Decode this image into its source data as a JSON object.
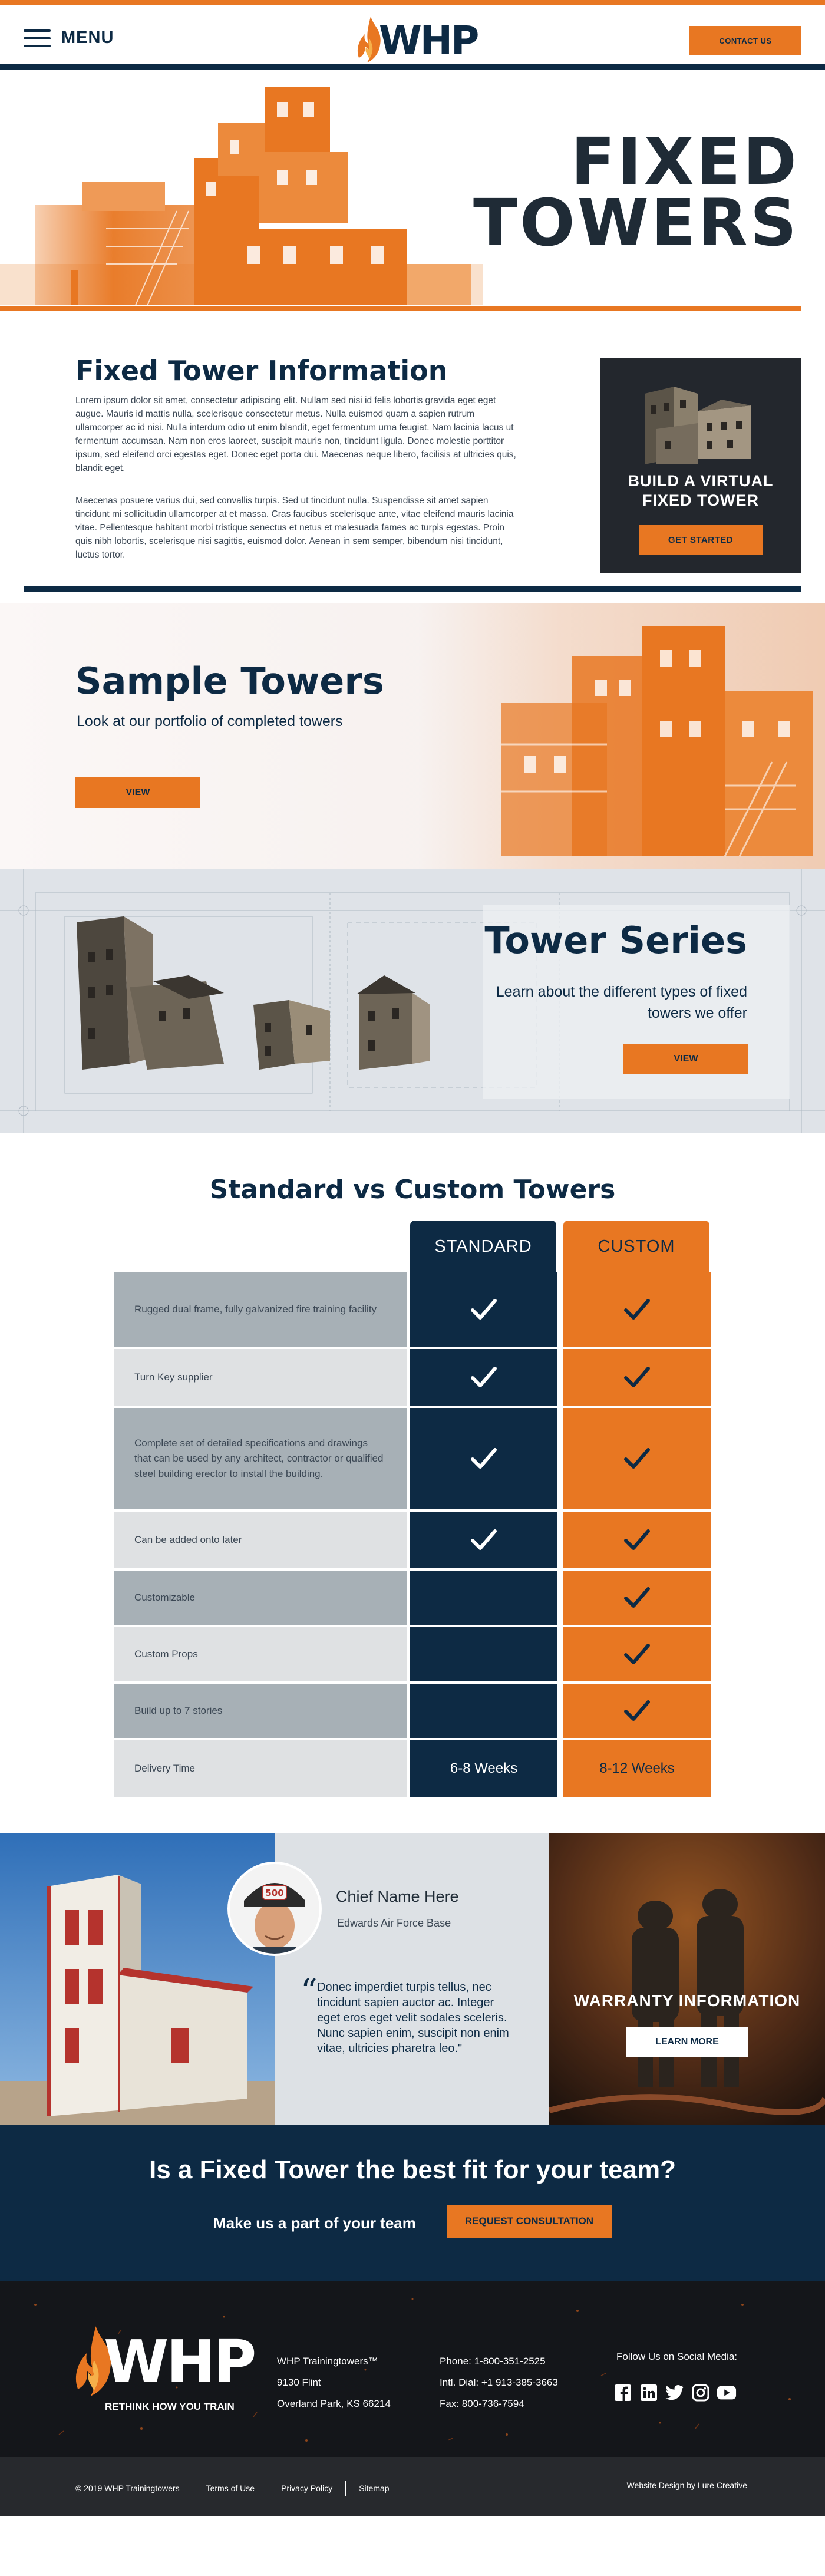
{
  "header": {
    "menu_label": "MENU",
    "logo_text": "WHP",
    "contact_label": "CONTACT US"
  },
  "hero": {
    "title_line1": "FIXED",
    "title_line2": "TOWERS"
  },
  "info": {
    "title": "Fixed Tower Information",
    "paragraph1": "Lorem ipsum dolor sit amet, consectetur adipiscing elit. Nullam sed nisi id felis lobortis gravida eget eget augue. Mauris id mattis nulla, scelerisque consectetur metus. Nulla euismod quam a sapien rutrum ullamcorper ac id nisi. Nulla interdum odio ut enim blandit, eget fermentum urna feugiat. Nam lacinia lacus ut fermentum accumsan. Nam non eros laoreet, suscipit mauris non, tincidunt ligula. Donec molestie porttitor ipsum, sed eleifend orci egestas eget. Donec eget porta dui. Maecenas neque libero, facilisis at ultricies quis, blandit eget.",
    "paragraph2": "Maecenas posuere varius dui, sed convallis turpis. Sed ut tincidunt nulla. Suspendisse sit amet sapien tincidunt mi sollicitudin ullamcorper at et massa. Cras faucibus scelerisque ante, vitae eleifend mauris lacinia vitae. Pellentesque habitant morbi tristique senectus et netus et malesuada fames ac turpis egestas. Proin quis nibh lobortis, scelerisque nisi sagittis, euismod dolor. Aenean in sem semper, bibendum nisi tincidunt, luctus tortor.",
    "card_title_line1": "BUILD A VIRTUAL",
    "card_title_line2": "FIXED TOWER",
    "card_button": "GET STARTED"
  },
  "sample": {
    "title": "Sample Towers",
    "subtitle": "Look at our portfolio of completed towers",
    "button": "VIEW"
  },
  "series": {
    "title": "Tower Series",
    "subtitle": "Learn about the different types of fixed towers we offer",
    "button": "VIEW"
  },
  "compare": {
    "title": "Standard vs Custom Towers",
    "standard_label": "STANDARD",
    "custom_label": "CUSTOM",
    "rows": [
      {
        "label": "Rugged dual frame, fully galvanized fire training facility",
        "standard": true,
        "custom": true
      },
      {
        "label": "Turn Key supplier",
        "standard": true,
        "custom": true
      },
      {
        "label": "Complete set of detailed specifications and drawings that can be used by any architect, contractor or qualified steel building erector to install the building.",
        "standard": true,
        "custom": true
      },
      {
        "label": "Can be added onto later",
        "standard": true,
        "custom": true
      },
      {
        "label": "Customizable",
        "standard": false,
        "custom": true
      },
      {
        "label": "Custom Props",
        "standard": false,
        "custom": true
      },
      {
        "label": "Build up to 7 stories",
        "standard": false,
        "custom": true
      },
      {
        "label": "Delivery Time",
        "standard_text": "6-8 Weeks",
        "custom_text": "8-12 Weeks"
      }
    ]
  },
  "testimonial": {
    "badge": "500",
    "name": "Chief Name Here",
    "base": "Edwards Air Force Base",
    "quote": "Donec imperdiet turpis tellus, nec tincidunt sapien auctor ac. Integer eget eros eget velit sodales sceleris. Nunc sapien enim, suscipit non enim vitae, ultricies pharetra leo.\""
  },
  "warranty": {
    "title": "WARRANTY INFORMATION",
    "button": "LEARN MORE"
  },
  "cta": {
    "title": "Is a Fixed Tower the best fit for your team?",
    "subtitle": "Make us a part of your team",
    "button": "REQUEST CONSULTATION"
  },
  "footer": {
    "logo_text": "WHP",
    "tagline": "RETHINK HOW YOU TRAIN",
    "company": "WHP Trainingtowers™",
    "address1": "9130 Flint",
    "address2": "Overland Park, KS 66214",
    "phone": "Phone: 1-800-351-2525",
    "intl": "Intl. Dial: +1 913-385-3663",
    "fax": "Fax: 800-736-7594",
    "social_title": "Follow Us on Social Media:",
    "social_icons": [
      "facebook-icon",
      "linkedin-icon",
      "twitter-icon",
      "instagram-icon",
      "youtube-icon"
    ]
  },
  "bottom": {
    "copyright": "© 2019 WHP Trainingtowers",
    "terms": "Terms of Use",
    "privacy": "Privacy Policy",
    "sitemap": "Sitemap",
    "credit": "Website Design by Lure Creative"
  },
  "colors": {
    "navy": "#0d2a44",
    "orange": "#e87722",
    "dark": "#23272d"
  }
}
